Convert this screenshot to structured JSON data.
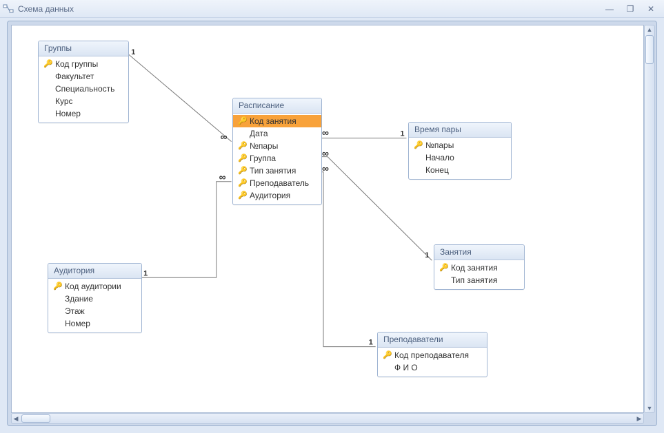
{
  "window": {
    "title": "Схема данных",
    "minimize_symbol": "—",
    "restore_symbol": "❐",
    "close_symbol": "✕"
  },
  "tables": {
    "groups": {
      "title": "Группы",
      "fields": [
        "Код группы",
        "Факультет",
        "Специальность",
        "Курс",
        "Номер"
      ],
      "pk": [
        true,
        false,
        false,
        false,
        false
      ],
      "selected": -1
    },
    "schedule": {
      "title": "Расписание",
      "fields": [
        "Код занятия",
        "Дата",
        "№пары",
        "Группа",
        "Тип занятия",
        "Преподаватель",
        "Аудитория"
      ],
      "pk": [
        true,
        false,
        true,
        true,
        true,
        true,
        true
      ],
      "selected": 0
    },
    "timeslot": {
      "title": "Время пары",
      "fields": [
        "№пары",
        "Начало",
        "Конец"
      ],
      "pk": [
        true,
        false,
        false
      ],
      "selected": -1
    },
    "audit": {
      "title": "Аудитория",
      "fields": [
        "Код аудитории",
        "Здание",
        "Этаж",
        "Номер"
      ],
      "pk": [
        true,
        false,
        false,
        false
      ],
      "selected": -1
    },
    "lessons": {
      "title": "Занятия",
      "fields": [
        "Код занятия",
        "Тип занятия"
      ],
      "pk": [
        true,
        false
      ],
      "selected": -1
    },
    "teachers": {
      "title": "Преподаватели",
      "fields": [
        "Код преподавателя",
        "Ф И О"
      ],
      "pk": [
        true,
        false
      ],
      "selected": -1
    }
  },
  "relationships": [
    {
      "from": "groups",
      "to": "schedule",
      "card_from": "1",
      "card_to": "∞"
    },
    {
      "from": "audit",
      "to": "schedule",
      "card_from": "1",
      "card_to": "∞"
    },
    {
      "from": "timeslot",
      "to": "schedule",
      "card_from": "1",
      "card_to": "∞"
    },
    {
      "from": "lessons",
      "to": "schedule",
      "card_from": "1",
      "card_to": "∞"
    },
    {
      "from": "teachers",
      "to": "schedule",
      "card_from": "1",
      "card_to": "∞"
    }
  ],
  "colors": {
    "accent_selected": "#f8a23a",
    "border": "#9fb4d2",
    "canvas_bg": "#ffffff",
    "frame_bg": "#cdd9eb",
    "outer_bg": "#dfe8f5"
  },
  "key_glyph": "🔑",
  "infinity_glyph": "∞",
  "one_glyph": "1"
}
